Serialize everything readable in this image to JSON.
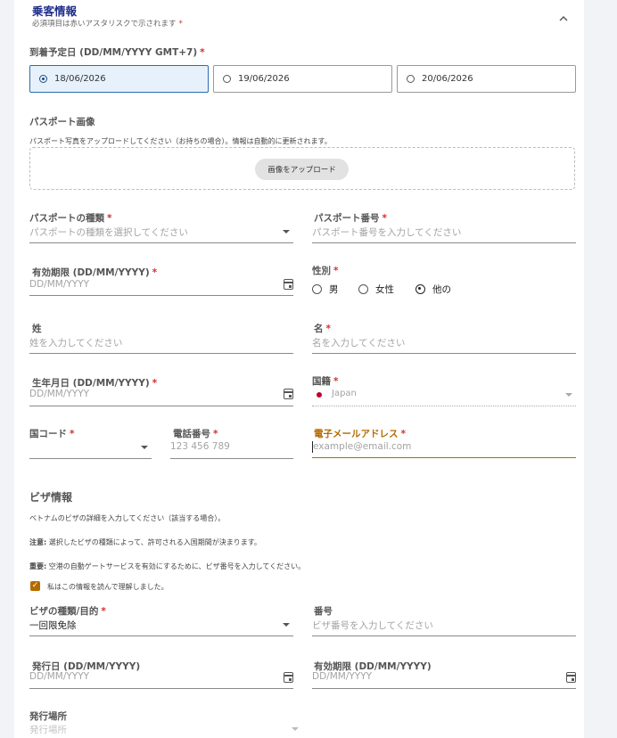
{
  "section": {
    "title": "乗客情報",
    "subtitle_prefix": "必須項目は赤いアスタリスクで示されます",
    "required_mark": "*",
    "collapse_icon": "chevron-up-icon"
  },
  "arrival": {
    "label": "到着予定日 (DD/MM/YYYY GMT+7)",
    "options": [
      "18/06/2026",
      "19/06/2026",
      "20/06/2026"
    ],
    "selected": "18/06/2026"
  },
  "passport_image": {
    "label": "パスポート画像",
    "hint": "パスポート写真をアップロードしてください（お持ちの場合）。情報は自動的に更新されます。",
    "upload_button": "画像をアップロード"
  },
  "passport_type": {
    "label": "パスポートの種類",
    "placeholder": "パスポートの種類を選択してください"
  },
  "passport_number": {
    "label": "パスポート番号",
    "placeholder": "パスポート番号を入力してください"
  },
  "expiry": {
    "label": "有効期限 (DD/MM/YYYY)",
    "placeholder": "DD/MM/YYYY"
  },
  "gender": {
    "label": "性別",
    "options": [
      "男",
      "女性",
      "他の"
    ],
    "selected": "他の"
  },
  "last_name": {
    "label": "姓",
    "placeholder": "姓を入力してください"
  },
  "first_name": {
    "label": "名",
    "placeholder": "名を入力してください"
  },
  "dob": {
    "label": "生年月日 (DD/MM/YYYY)",
    "placeholder": "DD/MM/YYYY"
  },
  "nationality": {
    "label": "国籍",
    "value": "Japan",
    "flag_color": "#bc002d"
  },
  "country_code": {
    "label": "国コード"
  },
  "phone": {
    "label": "電話番号",
    "placeholder": "123 456 789"
  },
  "email": {
    "label": "電子メールアドレス",
    "placeholder": "example@email.com",
    "accent": "#b46a00"
  },
  "visa": {
    "title": "ビザ情報",
    "intro": "ベトナムのビザの詳細を入力してください（該当する場合）。",
    "note_prefix": "注意:",
    "note_text": "選択したビザの種類によって、許可される入国期間が決まります。",
    "important_prefix": "重要:",
    "important_text": "空港の自動ゲートサービスを有効にするために、ビザ番号を入力してください。",
    "ack_label": "私はこの情報を読んで理解しました。",
    "ack_checked": true
  },
  "visa_type": {
    "label": "ビザの種類/目的",
    "value": "一回限免除"
  },
  "visa_number": {
    "label": "番号",
    "placeholder": "ビザ番号を入力してください"
  },
  "issue_date": {
    "label": "発行日 (DD/MM/YYYY)",
    "placeholder": "DD/MM/YYYY"
  },
  "visa_expiry": {
    "label": "有効期限 (DD/MM/YYYY)",
    "placeholder": "DD/MM/YYYY"
  },
  "issue_place": {
    "label": "発行場所",
    "placeholder": "発行場所"
  }
}
